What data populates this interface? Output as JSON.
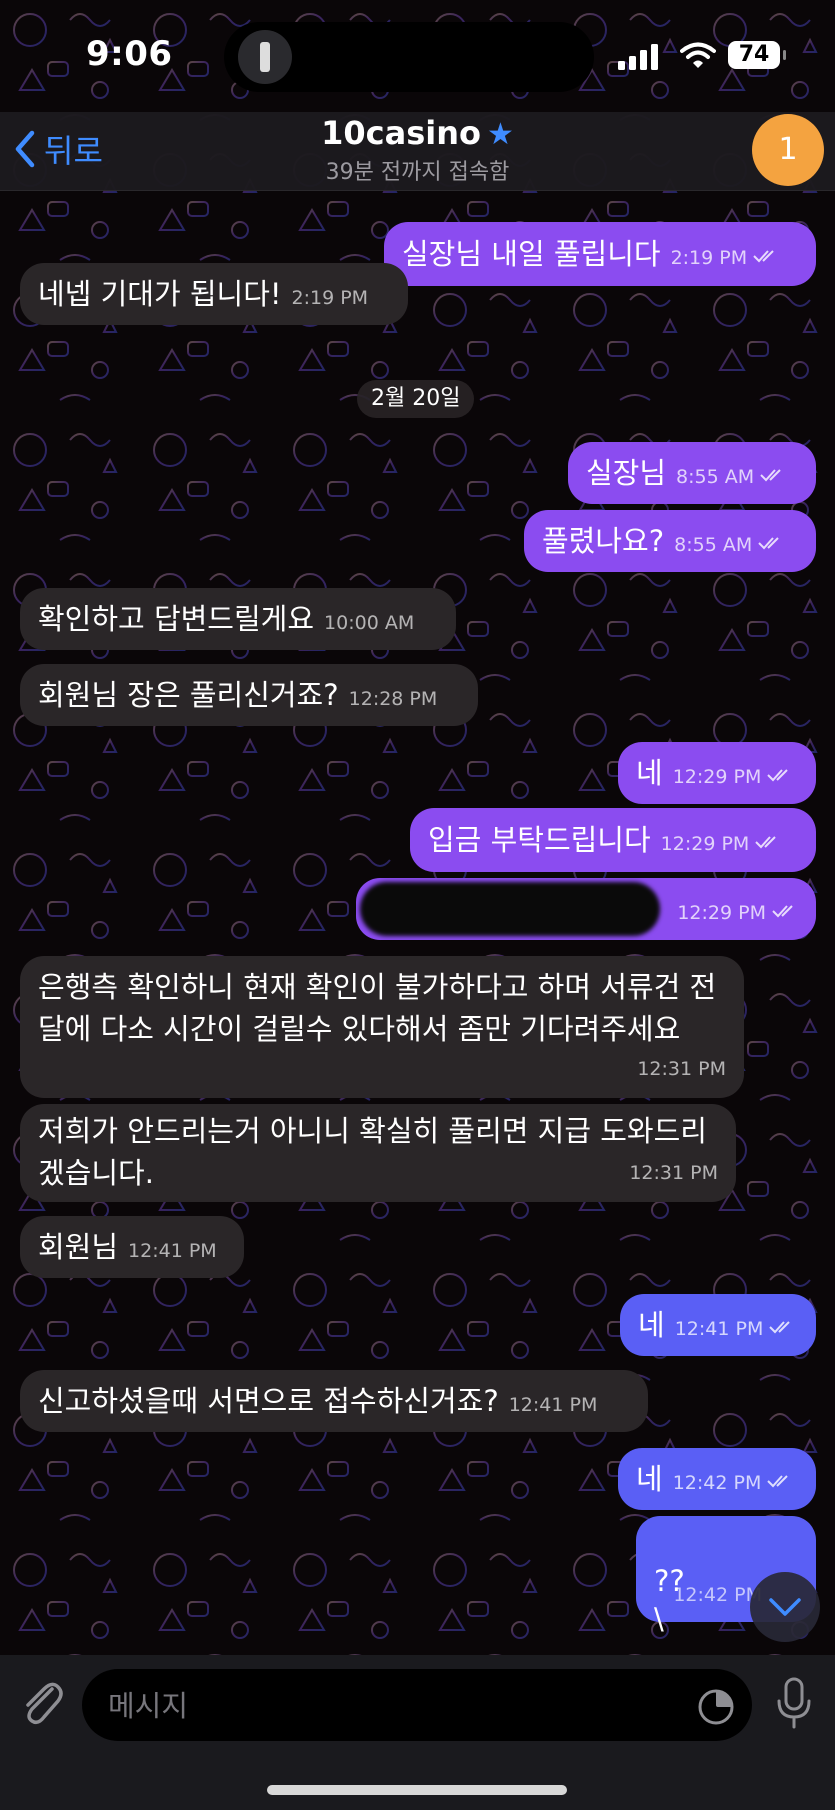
{
  "status": {
    "time": "9:06",
    "battery": "74"
  },
  "header": {
    "back_label": "뒤로",
    "title": "10casino",
    "subtitle": "39분 전까지 접속함",
    "badge": "1"
  },
  "date_separator": "2월 20일",
  "messages": [
    {
      "dir": "out",
      "text": "실장님 내일 풀립니다",
      "time": "2:19 PM"
    },
    {
      "dir": "in",
      "text": "네넵 기대가 됩니다!",
      "time": "2:19 PM"
    },
    {
      "dir": "out",
      "text": "실장님",
      "time": "8:55 AM"
    },
    {
      "dir": "out",
      "text": "풀렸나요?",
      "time": "8:55 AM"
    },
    {
      "dir": "in",
      "text": "확인하고 답변드릴게요",
      "time": "10:00 AM"
    },
    {
      "dir": "in",
      "text": "회원님 장은 풀리신거죠?",
      "time": "12:28 PM"
    },
    {
      "dir": "out",
      "text": "네",
      "time": "12:29 PM"
    },
    {
      "dir": "out",
      "text": "입금 부탁드립니다",
      "time": "12:29 PM"
    },
    {
      "dir": "out",
      "text": "",
      "time": "12:29 PM"
    },
    {
      "dir": "in",
      "text": "은행측 확인하니 현재 확인이 불가하다고 하며 서류건 전달에 다소 시간이 걸릴수 있다해서 좀만 기다려주세요",
      "time": "12:31 PM"
    },
    {
      "dir": "in",
      "text": "저희가 안드리는거 아니니 확실히 풀리면 지급 도와드리겠습니다.",
      "time": "12:31 PM"
    },
    {
      "dir": "in",
      "text": "회원님",
      "time": "12:41 PM"
    },
    {
      "dir": "out",
      "text": "네",
      "time": "12:41 PM"
    },
    {
      "dir": "in",
      "text": "신고하셨을때 서면으로 접수하신거죠?",
      "time": "12:41 PM"
    },
    {
      "dir": "out",
      "text": "네",
      "time": "12:42 PM"
    },
    {
      "dir": "out",
      "text": "??\n\\",
      "time": "12:42 PM"
    }
  ],
  "input": {
    "placeholder": "메시지"
  },
  "colors": {
    "outgoing": "#8b4cf0",
    "outgoing_late": "#5a5ff5",
    "incoming": "#2a2628",
    "accent": "#3f8cff",
    "avatar": "#f4a340"
  },
  "icons": [
    "back-chevron-icon",
    "verified-star-icon",
    "read-checkmarks-icon",
    "scroll-down-icon",
    "attach-icon",
    "sticker-icon",
    "mic-icon"
  ]
}
